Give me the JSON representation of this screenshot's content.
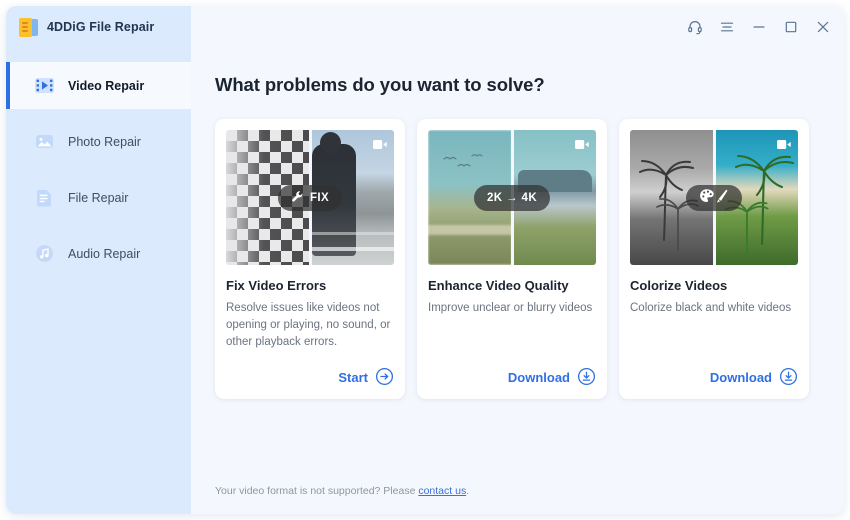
{
  "window": {
    "app_title": "4DDiG File Repair",
    "app_icon": "app-document-icon",
    "controls": [
      {
        "name": "support-headset-icon",
        "glyph": "headset"
      },
      {
        "name": "menu-icon",
        "glyph": "menu"
      },
      {
        "name": "minimize-icon",
        "glyph": "minimize"
      },
      {
        "name": "maximize-icon",
        "glyph": "maximize"
      },
      {
        "name": "close-icon",
        "glyph": "close"
      }
    ]
  },
  "sidebar": {
    "items": [
      {
        "label": "Video Repair",
        "icon": "video-film-icon",
        "active": true
      },
      {
        "label": "Photo Repair",
        "icon": "image-icon",
        "active": false
      },
      {
        "label": "File Repair",
        "icon": "document-icon",
        "active": false
      },
      {
        "label": "Audio Repair",
        "icon": "music-note-icon",
        "active": false
      }
    ]
  },
  "main": {
    "title": "What problems do you want to solve?",
    "cards": [
      {
        "title": "Fix Video Errors",
        "desc": "Resolve issues like videos not opening or playing, no sound, or other playback errors.",
        "badge": "FIX",
        "badge_icon": "wrench-icon",
        "action": "Start",
        "action_icon": "arrow-right-circle-icon"
      },
      {
        "title": "Enhance Video Quality",
        "desc": "Improve unclear or blurry videos",
        "badge": "2K → 4K",
        "badge_icon": "",
        "action": "Download",
        "action_icon": "download-circle-icon"
      },
      {
        "title": "Colorize Videos",
        "desc": "Colorize black and white videos",
        "badge": "",
        "badge_icon": "palette-brush-icon",
        "action": "Download",
        "action_icon": "download-circle-icon"
      }
    ]
  },
  "footer": {
    "text_before": "Your video format is not supported? Please ",
    "link": "contact us",
    "text_after": "."
  },
  "colors": {
    "accent": "#2f6fe4",
    "sidebar_bg": "#dbeafd",
    "content_bg": "#f4f7fd",
    "card_bg": "#ffffff",
    "title_text": "#1b2430",
    "muted_text": "#6b7480"
  }
}
